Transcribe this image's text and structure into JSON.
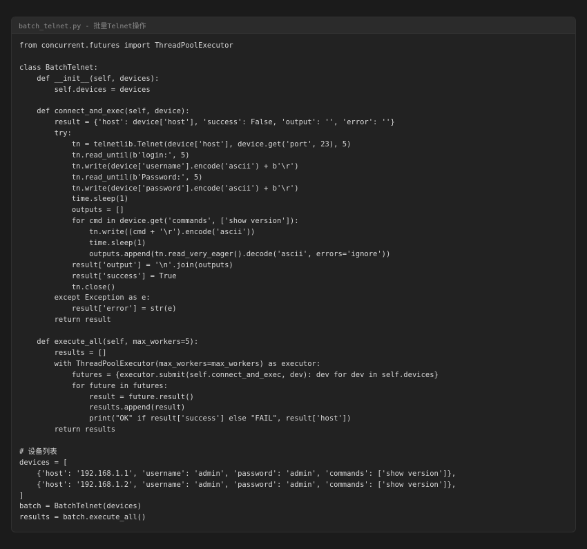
{
  "header": {
    "title": "batch_telnet.py - 批量Telnet操作"
  },
  "code_lines": [
    "from concurrent.futures import ThreadPoolExecutor",
    "",
    "class BatchTelnet:",
    "    def __init__(self, devices):",
    "        self.devices = devices",
    "",
    "    def connect_and_exec(self, device):",
    "        result = {'host': device['host'], 'success': False, 'output': '', 'error': ''}",
    "        try:",
    "            tn = telnetlib.Telnet(device['host'], device.get('port', 23), 5)",
    "            tn.read_until(b'login:', 5)",
    "            tn.write(device['username'].encode('ascii') + b'\\r')",
    "            tn.read_until(b'Password:', 5)",
    "            tn.write(device['password'].encode('ascii') + b'\\r')",
    "            time.sleep(1)",
    "            outputs = []",
    "            for cmd in device.get('commands', ['show version']):",
    "                tn.write((cmd + '\\r').encode('ascii'))",
    "                time.sleep(1)",
    "                outputs.append(tn.read_very_eager().decode('ascii', errors='ignore'))",
    "            result['output'] = '\\n'.join(outputs)",
    "            result['success'] = True",
    "            tn.close()",
    "        except Exception as e:",
    "            result['error'] = str(e)",
    "        return result",
    "",
    "    def execute_all(self, max_workers=5):",
    "        results = []",
    "        with ThreadPoolExecutor(max_workers=max_workers) as executor:",
    "            futures = {executor.submit(self.connect_and_exec, dev): dev for dev in self.devices}",
    "            for future in futures:",
    "                result = future.result()",
    "                results.append(result)",
    "                print(\"OK\" if result['success'] else \"FAIL\", result['host'])",
    "        return results",
    "",
    "# 设备列表",
    "devices = [",
    "    {'host': '192.168.1.1', 'username': 'admin', 'password': 'admin', 'commands': ['show version']},",
    "    {'host': '192.168.1.2', 'username': 'admin', 'password': 'admin', 'commands': ['show version']},",
    "]",
    "batch = BatchTelnet(devices)",
    "results = batch.execute_all()"
  ],
  "colors": {
    "page_background": "#1b1b1b",
    "window_background": "#222222",
    "header_background": "#2b2b2b",
    "title_text": "#8a8a8a",
    "code_text": "#d6d6d6"
  }
}
